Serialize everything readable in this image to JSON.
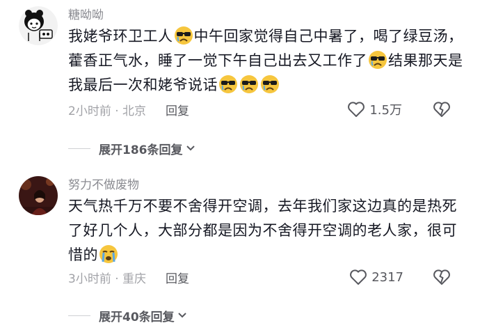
{
  "comments": [
    {
      "username": "糖呦呦",
      "text_parts": [
        "我姥爷环卫工人",
        "中午回家觉得自己中暑了，喝了绿豆汤，藿香正气水，睡了一觉下午自己出去又工作了",
        "结果那天是我最后一次和姥爷说话"
      ],
      "emoji_name": "sad-sunglasses-emoji",
      "time_location": "2小时前 · 北京",
      "reply_label": "回复",
      "like_count": "1.5万",
      "expand_label": "展开186条回复"
    },
    {
      "username": "努力不做废物",
      "text_parts": [
        "天气热千万不要不舍得开空调，去年我们家这边真的是热死了好几个人，大部分都是因为不舍得开空调的老人家，很可惜的"
      ],
      "emoji_name": "crying-emoji",
      "time_location": "3小时前 · 重庆",
      "reply_label": "回复",
      "like_count": "2317",
      "expand_label": "展开40条回复"
    }
  ]
}
